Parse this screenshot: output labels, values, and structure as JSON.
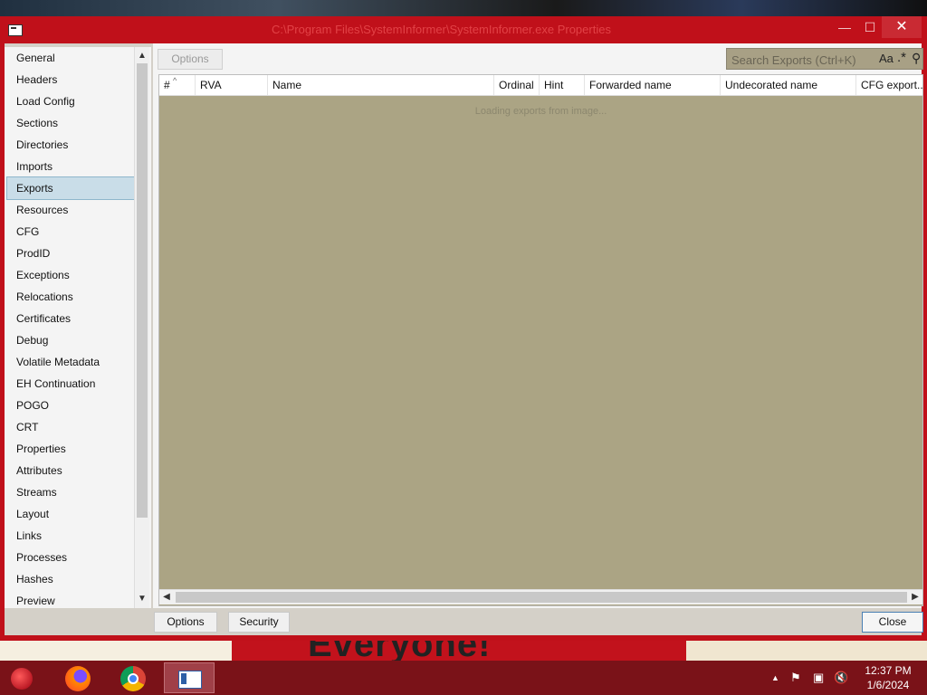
{
  "window": {
    "title": "C:\\Program Files\\SystemInformer\\SystemInformer.exe Properties",
    "minimize_glyph": "—",
    "maximize_glyph": "☐",
    "close_glyph": "✕"
  },
  "sidebar": {
    "items": [
      {
        "label": "General"
      },
      {
        "label": "Headers"
      },
      {
        "label": "Load Config"
      },
      {
        "label": "Sections"
      },
      {
        "label": "Directories"
      },
      {
        "label": "Imports"
      },
      {
        "label": "Exports",
        "selected": true
      },
      {
        "label": "Resources"
      },
      {
        "label": "CFG"
      },
      {
        "label": "ProdID"
      },
      {
        "label": "Exceptions"
      },
      {
        "label": "Relocations"
      },
      {
        "label": "Certificates"
      },
      {
        "label": "Debug"
      },
      {
        "label": "Volatile Metadata"
      },
      {
        "label": "EH Continuation"
      },
      {
        "label": "POGO"
      },
      {
        "label": "CRT"
      },
      {
        "label": "Properties"
      },
      {
        "label": "Attributes"
      },
      {
        "label": "Streams"
      },
      {
        "label": "Layout"
      },
      {
        "label": "Links"
      },
      {
        "label": "Processes"
      },
      {
        "label": "Hashes"
      },
      {
        "label": "Preview"
      }
    ]
  },
  "toolbar": {
    "options_label": "Options",
    "search_placeholder": "Search Exports (Ctrl+K)",
    "case_toggle": "Aa",
    "regex_toggle": ".*"
  },
  "grid": {
    "columns": [
      "#",
      "RVA",
      "Name",
      "Ordinal",
      "Hint",
      "Forwarded name",
      "Undecorated name",
      "CFG export..."
    ],
    "loading_text": "Loading exports from image..."
  },
  "footer": {
    "options_label": "Options",
    "security_label": "Security",
    "close_label": "Close"
  },
  "taskbar": {
    "items": [
      "start-orb",
      "firefox",
      "chrome",
      "pe-viewer"
    ],
    "clock_time": "12:37 PM",
    "clock_date": "1/6/2024"
  },
  "wallpaper": {
    "banner_text": "Everyone!"
  },
  "colors": {
    "window_frame": "#c0101a",
    "grid_background": "#aba484",
    "selection": "#c9dde8",
    "taskbar": "#7a1218"
  }
}
